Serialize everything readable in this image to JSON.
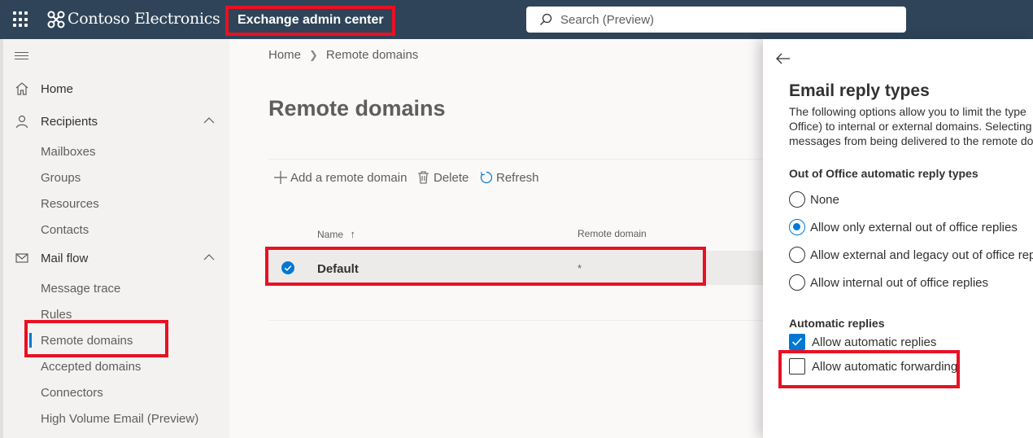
{
  "header": {
    "brand": "Contoso Electronics",
    "app_title": "Exchange admin center",
    "search_placeholder": "Search (Preview)"
  },
  "nav": {
    "items": [
      {
        "label": "Home"
      },
      {
        "label": "Recipients"
      },
      {
        "label": "Mail flow"
      }
    ],
    "recipients_children": [
      "Mailboxes",
      "Groups",
      "Resources",
      "Contacts"
    ],
    "mailflow_children": [
      "Message trace",
      "Rules",
      "Remote domains",
      "Accepted domains",
      "Connectors",
      "High Volume Email (Preview)"
    ]
  },
  "breadcrumb": {
    "home": "Home",
    "current": "Remote domains"
  },
  "page": {
    "title": "Remote domains",
    "commands": {
      "add": "Add a remote domain",
      "delete": "Delete",
      "refresh": "Refresh"
    },
    "columns": {
      "name": "Name",
      "domain": "Remote domain"
    },
    "rows": [
      {
        "name": "Default",
        "domain": "*",
        "selected": true
      }
    ]
  },
  "panel": {
    "title": "Email reply types",
    "description": [
      "The following options allow you to limit the type",
      "Office) to internal or external domains. Selecting",
      "messages from being delivered to the remote do"
    ],
    "ooo_section": "Out of Office automatic reply types",
    "ooo_options": [
      {
        "label": "None",
        "selected": false
      },
      {
        "label": "Allow only external out of office replies",
        "selected": true
      },
      {
        "label": "Allow external and legacy out of office replies",
        "selected": false
      },
      {
        "label": "Allow internal out of office replies",
        "selected": false
      }
    ],
    "auto_section": "Automatic replies",
    "auto_replies": {
      "label": "Allow automatic replies",
      "checked": true
    },
    "auto_forwarding": {
      "label": "Allow automatic forwarding",
      "checked": false
    }
  },
  "colors": {
    "topbar": "#2f4459",
    "accent": "#0078d4",
    "highlight": "#e81123"
  }
}
